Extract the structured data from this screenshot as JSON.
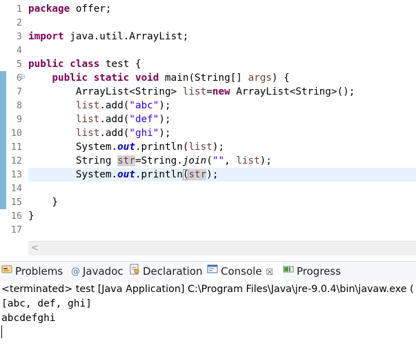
{
  "editor": {
    "line_numbers": [
      "1",
      "2",
      "3",
      "4",
      "5",
      "6",
      "7",
      "8",
      "9",
      "10",
      "11",
      "12",
      "13",
      "14",
      "15",
      "16",
      "17"
    ],
    "lines": [
      [
        {
          "t": "package",
          "c": "kw"
        },
        {
          "t": " offer;",
          "c": ""
        }
      ],
      [],
      [
        {
          "t": "import",
          "c": "kw"
        },
        {
          "t": " java.util.ArrayList;",
          "c": ""
        }
      ],
      [],
      [
        {
          "t": "public",
          "c": "kw"
        },
        {
          "t": " ",
          "c": ""
        },
        {
          "t": "class",
          "c": "kw"
        },
        {
          "t": " test {",
          "c": ""
        }
      ],
      [
        {
          "t": "    ",
          "c": ""
        },
        {
          "t": "public",
          "c": "kw"
        },
        {
          "t": " ",
          "c": ""
        },
        {
          "t": "static",
          "c": "kw"
        },
        {
          "t": " ",
          "c": ""
        },
        {
          "t": "void",
          "c": "kw"
        },
        {
          "t": " main(String[] ",
          "c": ""
        },
        {
          "t": "args",
          "c": "var"
        },
        {
          "t": ") {",
          "c": ""
        }
      ],
      [
        {
          "t": "        ArrayList<String> ",
          "c": ""
        },
        {
          "t": "list",
          "c": "var"
        },
        {
          "t": "=",
          "c": ""
        },
        {
          "t": "new",
          "c": "kw"
        },
        {
          "t": " ArrayList<String>();",
          "c": ""
        }
      ],
      [
        {
          "t": "        ",
          "c": ""
        },
        {
          "t": "list",
          "c": "var"
        },
        {
          "t": ".add(",
          "c": ""
        },
        {
          "t": "\"abc\"",
          "c": "str"
        },
        {
          "t": ");",
          "c": ""
        }
      ],
      [
        {
          "t": "        ",
          "c": ""
        },
        {
          "t": "list",
          "c": "var"
        },
        {
          "t": ".add(",
          "c": ""
        },
        {
          "t": "\"def\"",
          "c": "str"
        },
        {
          "t": ");",
          "c": ""
        }
      ],
      [
        {
          "t": "        ",
          "c": ""
        },
        {
          "t": "list",
          "c": "var"
        },
        {
          "t": ".add(",
          "c": ""
        },
        {
          "t": "\"ghi\"",
          "c": "str"
        },
        {
          "t": ");",
          "c": ""
        }
      ],
      [
        {
          "t": "        System.",
          "c": ""
        },
        {
          "t": "out",
          "c": "sfield"
        },
        {
          "t": ".println(",
          "c": ""
        },
        {
          "t": "list",
          "c": "var"
        },
        {
          "t": ");",
          "c": ""
        }
      ],
      [
        {
          "t": "        String ",
          "c": ""
        },
        {
          "t": "str",
          "c": "var occ"
        },
        {
          "t": "=String.",
          "c": ""
        },
        {
          "t": "join",
          "c": "smethod"
        },
        {
          "t": "(",
          "c": ""
        },
        {
          "t": "\"\"",
          "c": "str"
        },
        {
          "t": ", ",
          "c": ""
        },
        {
          "t": "list",
          "c": "var"
        },
        {
          "t": ");",
          "c": ""
        }
      ],
      [
        {
          "t": "        System.",
          "c": ""
        },
        {
          "t": "out",
          "c": "sfield"
        },
        {
          "t": ".println",
          "c": ""
        },
        {
          "t": "(",
          "c": "brk"
        },
        {
          "t": "str",
          "c": "var occ"
        },
        {
          "t": ");",
          "c": ""
        }
      ],
      [],
      [
        {
          "t": "    }",
          "c": ""
        }
      ],
      [
        {
          "t": "}",
          "c": ""
        }
      ],
      []
    ],
    "changed_lines": [
      6,
      7,
      8,
      9,
      10,
      11,
      12,
      13,
      14,
      15
    ],
    "folded_line": 6,
    "current_line": 13,
    "fold_marker": "⊖",
    "scroll_left_glyph": "<"
  },
  "views": {
    "tabs": [
      {
        "label": "Problems",
        "icon": "problems-icon",
        "active": false
      },
      {
        "label": "Javadoc",
        "icon": "at-sign-icon",
        "active": false
      },
      {
        "label": "Declaration",
        "icon": "declaration-icon",
        "active": false
      },
      {
        "label": "Console",
        "icon": "console-icon",
        "active": true
      },
      {
        "label": "Progress",
        "icon": "progress-icon",
        "active": false
      }
    ],
    "close_glyph": "☒"
  },
  "console": {
    "description": "<terminated> test [Java Application] C:\\Program Files\\Java\\jre-9.0.4\\bin\\javaw.exe (",
    "output": [
      "[abc, def, ghi]",
      "abcdefghi"
    ]
  },
  "colors": {
    "keyword": "#7f0055",
    "string": "#2a00ff",
    "local_variable": "#6a3e3e",
    "static_field": "#0000c0",
    "current_line": "#e8f2fe",
    "change_bar": "#7fb8d8"
  }
}
